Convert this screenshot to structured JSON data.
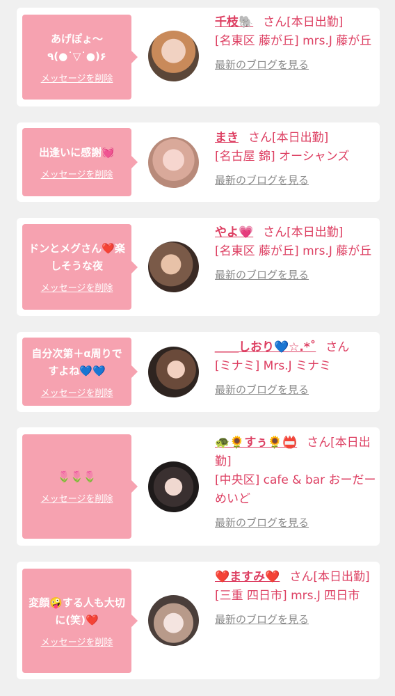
{
  "cards": [
    {
      "message": "あげぽょ〜٩(●˙▽˙●)۶",
      "delete_label": "メッセージを削除",
      "name": "千枝🐘",
      "suffix": "さん[本日出勤]",
      "location": "[名東区 藤が丘] mrs.J 藤が丘",
      "blog_label": "最新のブログを見る"
    },
    {
      "message": "出逢いに感謝💓",
      "delete_label": "メッセージを削除",
      "name": "まき",
      "suffix": "さん[本日出勤]",
      "location": "[名古屋 錦] オーシャンズ",
      "blog_label": "最新のブログを見る"
    },
    {
      "message": "ドンとメグさん❤️楽しそうな夜",
      "delete_label": "メッセージを削除",
      "name": "やよ💗",
      "suffix": "さん[本日出勤]",
      "location": "[名東区 藤が丘] mrs.J 藤が丘",
      "blog_label": "最新のブログを見る"
    },
    {
      "message": "自分次第＋α周りですよね💙💙",
      "delete_label": "メッセージを削除",
      "name": "＿＿しおり💙☆.*˚",
      "suffix": "さん",
      "location": "[ミナミ] Mrs.J ミナミ",
      "blog_label": "最新のブログを見る"
    },
    {
      "message": "🌷🌷🌷",
      "delete_label": "メッセージを削除",
      "name": "🐢🌻すぅ🌻📛",
      "suffix": "さん[本日出勤]",
      "location": "[中央区] cafe & bar おーだーめいど",
      "blog_label": "最新のブログを見る"
    },
    {
      "message": "変顔🤪する人も大切に(笑)❤️",
      "delete_label": "メッセージを削除",
      "name": "❤️ますみ❤️",
      "suffix": "さん[本日出勤]",
      "location": "[三重 四日市] mrs.J 四日市",
      "blog_label": "最新のブログを見る"
    }
  ]
}
